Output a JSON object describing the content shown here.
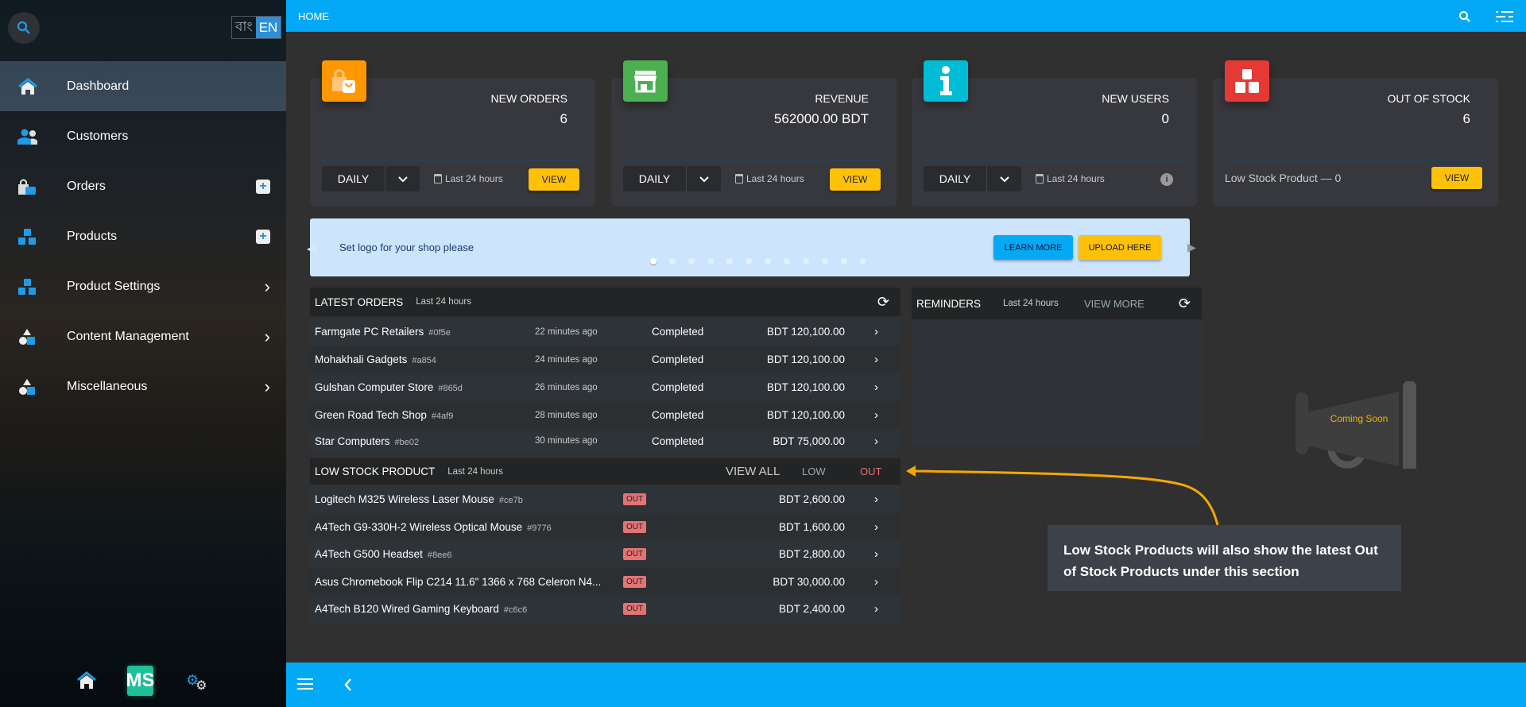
{
  "sidebar": {
    "language": {
      "bn": "বাং",
      "en": "EN"
    },
    "items": [
      {
        "label": "Dashboard",
        "icon": "home-icon",
        "active": true
      },
      {
        "label": "Customers",
        "icon": "users-icon"
      },
      {
        "label": "Orders",
        "icon": "shopping-bag-icon",
        "action": "plus"
      },
      {
        "label": "Products",
        "icon": "boxes-icon",
        "action": "plus"
      },
      {
        "label": "Product Settings",
        "icon": "boxes-icon",
        "action": "chevron"
      },
      {
        "label": "Content Management",
        "icon": "shapes-icon",
        "action": "chevron"
      },
      {
        "label": "Miscellaneous",
        "icon": "shapes-icon",
        "action": "chevron"
      }
    ],
    "footer": {
      "logo": "MS"
    }
  },
  "topbar": {
    "title": "HOME"
  },
  "cards": [
    {
      "title": "NEW ORDERS",
      "value": "6",
      "select": "DAILY",
      "period": "Last 24 hours",
      "button": "VIEW",
      "color": "#ff9800"
    },
    {
      "title": "REVENUE",
      "value": "562000.00 BDT",
      "select": "DAILY",
      "period": "Last 24 hours",
      "button": "VIEW",
      "color": "#4caf50"
    },
    {
      "title": "NEW USERS",
      "value": "0",
      "select": "DAILY",
      "period": "Last 24 hours",
      "color": "#00bcd4"
    },
    {
      "title": "OUT OF STOCK",
      "value": "6",
      "footer_text": "Low Stock Product — 0",
      "button": "VIEW",
      "color": "#e53935"
    }
  ],
  "banner": {
    "text": "Set logo for your shop please",
    "learn_more": "LEARN MORE",
    "upload": "UPLOAD HERE",
    "slides": 12,
    "active_slide": 1
  },
  "latest_orders": {
    "title": "LATEST ORDERS",
    "period": "Last 24 hours",
    "rows": [
      {
        "name": "Farmgate PC Retailers",
        "id": "#0f5e",
        "time": "22 minutes ago",
        "status": "Completed",
        "amount": "BDT 120,100.00"
      },
      {
        "name": "Mohakhali Gadgets",
        "id": "#a854",
        "time": "24 minutes ago",
        "status": "Completed",
        "amount": "BDT 120,100.00"
      },
      {
        "name": "Gulshan Computer Store",
        "id": "#865d",
        "time": "26 minutes ago",
        "status": "Completed",
        "amount": "BDT 120,100.00"
      },
      {
        "name": "Green Road Tech Shop",
        "id": "#4af9",
        "time": "28 minutes ago",
        "status": "Completed",
        "amount": "BDT 120,100.00"
      },
      {
        "name": "Star Computers",
        "id": "#be02",
        "time": "30 minutes ago",
        "status": "Completed",
        "amount": "BDT 75,000.00"
      }
    ]
  },
  "low_stock": {
    "title": "LOW STOCK PRODUCT",
    "period": "Last 24 hours",
    "view_all": "VIEW ALL",
    "low": "LOW",
    "out": "OUT",
    "rows": [
      {
        "name": "Logitech M325 Wireless Laser Mouse",
        "id": "#ce7b",
        "badge": "OUT",
        "amount": "BDT 2,600.00"
      },
      {
        "name": "A4Tech G9-330H-2 Wireless Optical Mouse",
        "id": "#9776",
        "badge": "OUT",
        "amount": "BDT 1,600.00"
      },
      {
        "name": "A4Tech G500 Headset",
        "id": "#8ee6",
        "badge": "OUT",
        "amount": "BDT 2,800.00"
      },
      {
        "name": "Asus Chromebook Flip C214 11.6\" 1366 x 768 Celeron N4...",
        "id": "",
        "badge": "OUT",
        "amount": "BDT 30,000.00"
      },
      {
        "name": "A4Tech B120 Wired Gaming Keyboard",
        "id": "#c6c6",
        "badge": "OUT",
        "amount": "BDT 2,400.00"
      }
    ]
  },
  "reminders": {
    "title": "REMINDERS",
    "period": "Last 24 hours",
    "view_more": "VIEW MORE"
  },
  "coming_soon": "Coming Soon",
  "annotation": {
    "text": "Low Stock Products will also show the latest Out of Stock Products under this section",
    "color": "#f5a800"
  }
}
